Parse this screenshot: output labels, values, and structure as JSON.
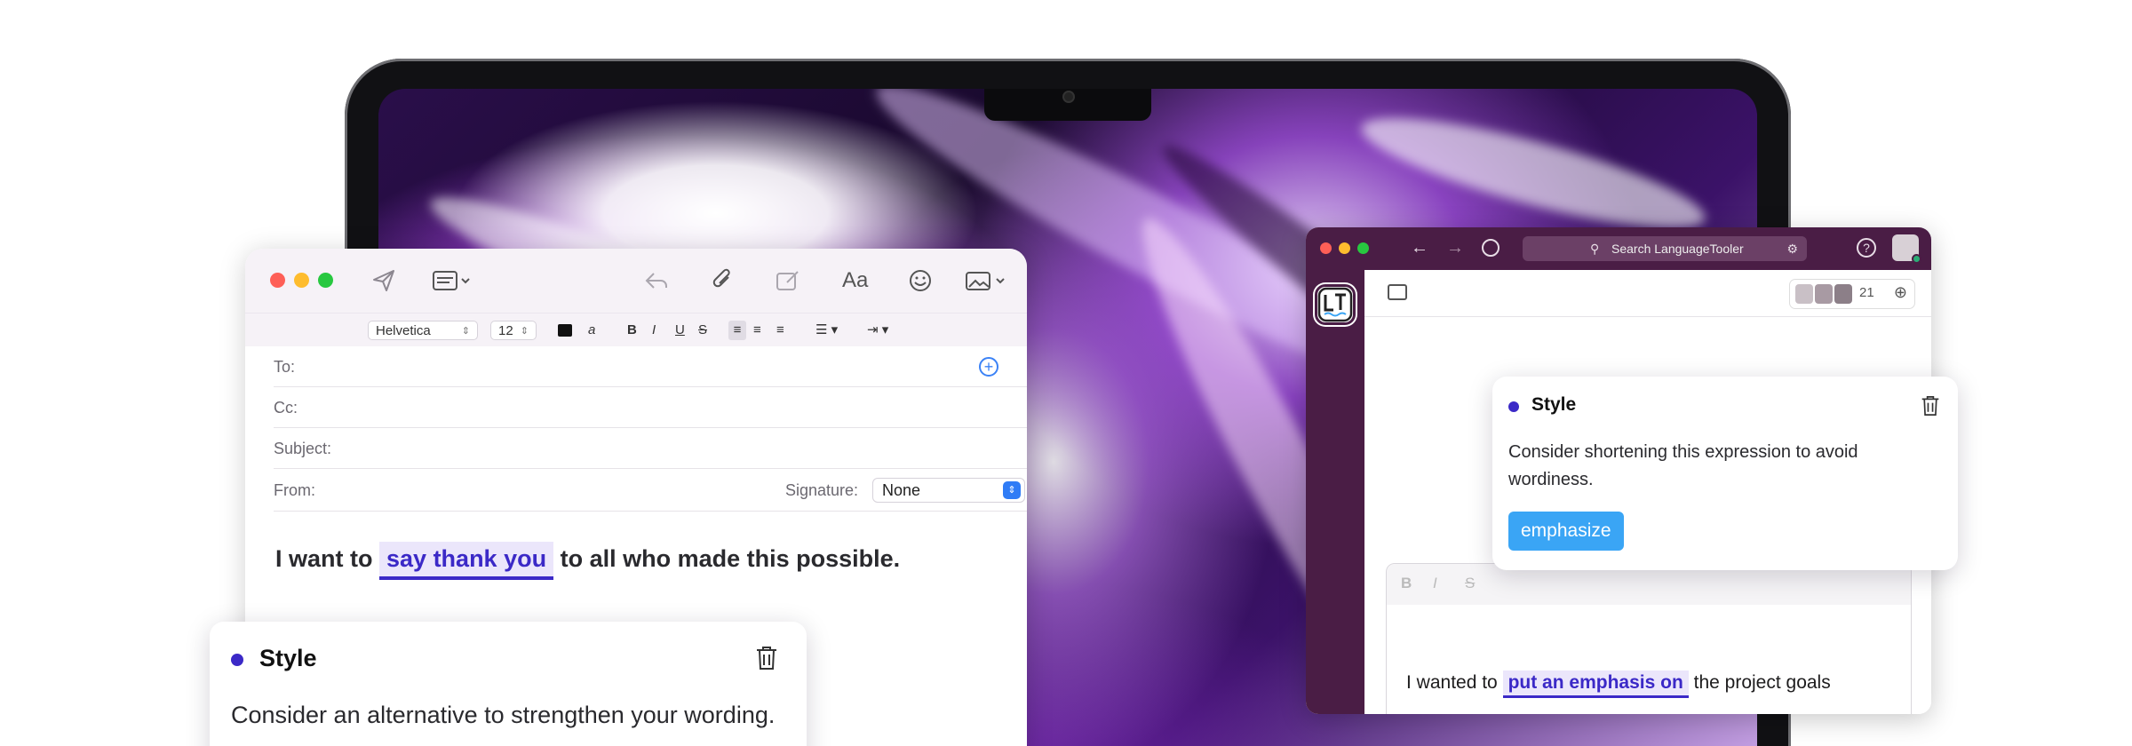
{
  "mail": {
    "format": {
      "font": "Helvetica",
      "size": "12"
    },
    "fields": {
      "to_label": "To:",
      "cc_label": "Cc:",
      "subject_label": "Subject:",
      "from_label": "From:",
      "signature_label": "Signature:",
      "signature_value": "None"
    },
    "body": {
      "before": "I want to",
      "highlight": "say thank you",
      "after": "to all who made this possible."
    }
  },
  "mail_card": {
    "title": "Style",
    "message": "Consider an alternative to strengthen your wording."
  },
  "slack": {
    "search_placeholder": "Search LanguageTooler",
    "member_count": "21",
    "message": {
      "before": "I wanted to",
      "highlight": "put an emphasis on",
      "after": "the project goals"
    },
    "format_icons": [
      "B",
      "I",
      "S"
    ]
  },
  "slack_card": {
    "title": "Style",
    "message": "Consider shortening this expression to avoid wordiness.",
    "suggestion": "emphasize"
  },
  "colors": {
    "accent": "#3b29c7",
    "highlight_bg": "#ebe6fb",
    "suggestion_btn": "#3aa5f5",
    "slack_aubergine": "#4a1d45"
  }
}
